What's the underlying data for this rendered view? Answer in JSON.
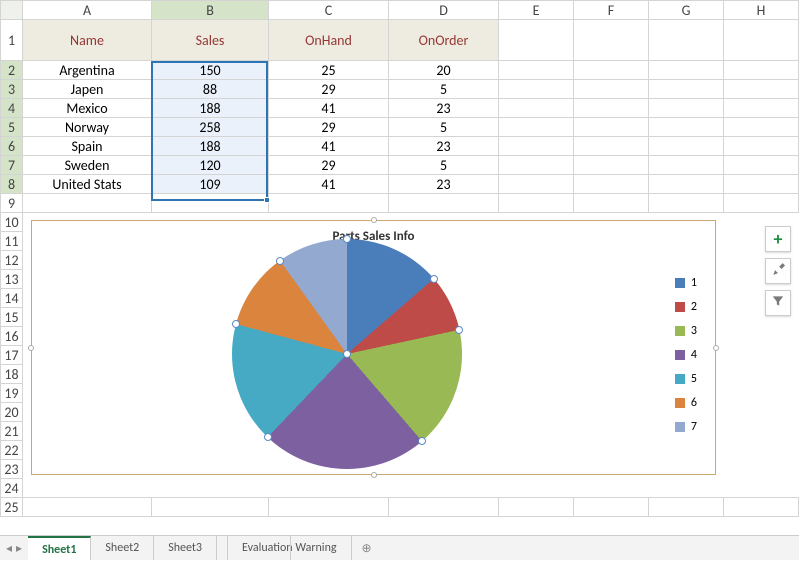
{
  "columns": [
    "A",
    "B",
    "C",
    "D",
    "E",
    "F",
    "G",
    "H"
  ],
  "rows": [
    "1",
    "2",
    "3",
    "4",
    "5",
    "6",
    "7",
    "8",
    "9",
    "10",
    "11",
    "12",
    "13",
    "14",
    "15",
    "16",
    "17",
    "18",
    "19",
    "20",
    "21",
    "22",
    "23",
    "24",
    "25"
  ],
  "hdr": {
    "name": "Name",
    "sales": "Sales",
    "onhand": "OnHand",
    "onorder": "OnOrder"
  },
  "data": [
    {
      "name": "Argentina",
      "sales": "150",
      "onhand": "25",
      "onorder": "20"
    },
    {
      "name": "Japen",
      "sales": "88",
      "onhand": "29",
      "onorder": "5"
    },
    {
      "name": "Mexico",
      "sales": "188",
      "onhand": "41",
      "onorder": "23"
    },
    {
      "name": "Norway",
      "sales": "258",
      "onhand": "29",
      "onorder": "5"
    },
    {
      "name": "Spain",
      "sales": "188",
      "onhand": "41",
      "onorder": "23"
    },
    {
      "name": "Sweden",
      "sales": "120",
      "onhand": "29",
      "onorder": "5"
    },
    {
      "name": "United Stats",
      "sales": "109",
      "onhand": "41",
      "onorder": "23"
    }
  ],
  "chart_data": {
    "type": "pie",
    "title": "Parts Sales Info",
    "series_name": "Sales",
    "categories": [
      "1",
      "2",
      "3",
      "4",
      "5",
      "6",
      "7"
    ],
    "values": [
      150,
      88,
      188,
      258,
      188,
      120,
      109
    ],
    "colors": [
      "#4a7ebb",
      "#be4b48",
      "#98b954",
      "#7d60a0",
      "#46aac5",
      "#db843d",
      "#93a9cf"
    ]
  },
  "tabs": {
    "s1": "Sheet1",
    "s2": "Sheet2",
    "s3": "Sheet3",
    "warn": "Evaluation Warning"
  }
}
